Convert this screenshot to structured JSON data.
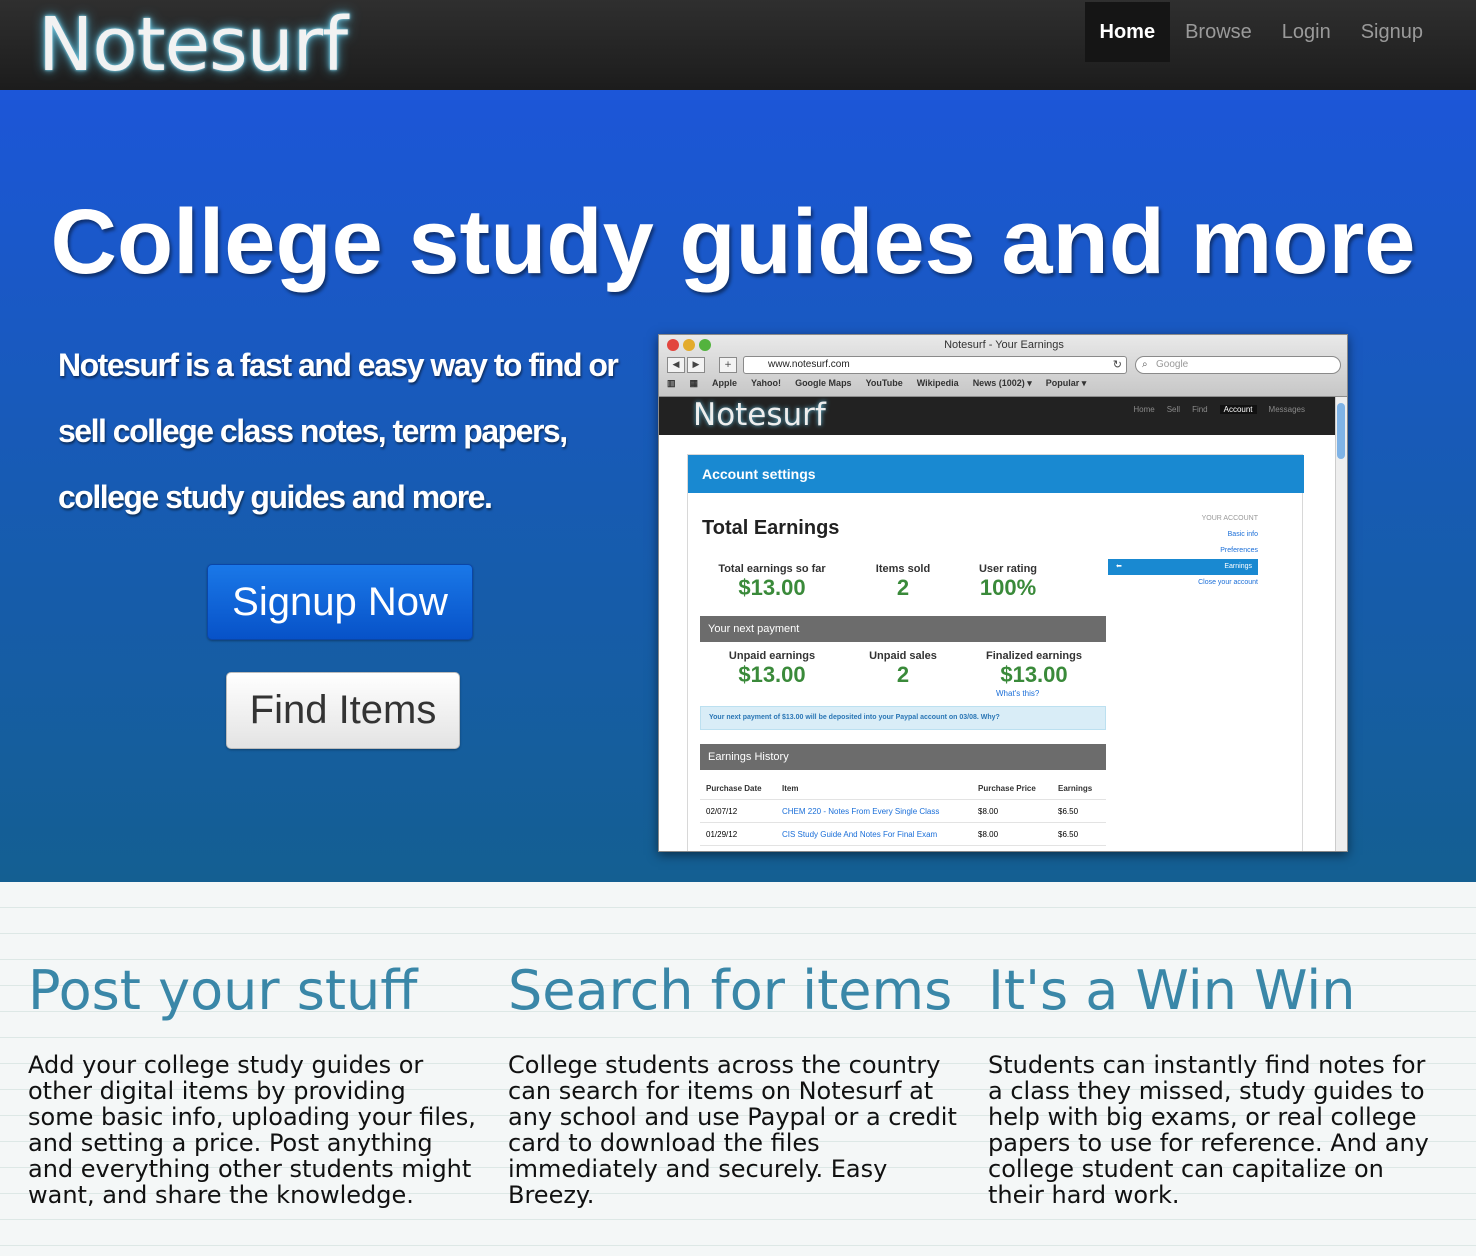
{
  "brand": {
    "logo": "Notesurf"
  },
  "nav": {
    "items": [
      "Home",
      "Browse",
      "Login",
      "Signup"
    ],
    "active": "Home"
  },
  "hero": {
    "title": "College study guides and more",
    "tagline": "Notesurf is a fast and easy way to find or sell college class notes, term papers, college study guides and more.",
    "signup_button": "Signup Now",
    "find_button": "Find Items"
  },
  "screenshot": {
    "window_title": "Notesurf - Your Earnings",
    "url": "www.notesurf.com",
    "search_placeholder": "Google",
    "bookmarks": [
      "Apple",
      "Yahoo!",
      "Google Maps",
      "YouTube",
      "Wikipedia",
      "News (1002) ▾",
      "Popular ▾"
    ],
    "inner_logo": "Notesurf",
    "inner_nav": [
      "Home",
      "Sell",
      "Find",
      "Account",
      "Messages"
    ],
    "panel_title": "Account settings",
    "total_title": "Total Earnings",
    "side_menu": {
      "header": "YOUR ACCOUNT",
      "items": [
        "Basic info",
        "Preferences",
        "Earnings",
        "Close your account"
      ]
    },
    "stats": [
      {
        "label": "Total earnings so far",
        "value": "$13.00"
      },
      {
        "label": "Items sold",
        "value": "2"
      },
      {
        "label": "User rating",
        "value": "100%"
      }
    ],
    "next_payment_bar": "Your next payment",
    "payment_stats": [
      {
        "label": "Unpaid earnings",
        "value": "$13.00"
      },
      {
        "label": "Unpaid sales",
        "value": "2"
      },
      {
        "label": "Finalized earnings",
        "value": "$13.00"
      }
    ],
    "whats_this": "What's this?",
    "notice": "Your next payment of $13.00 will be deposited into your Paypal account on 03/08. Why?",
    "history_bar": "Earnings History",
    "history_columns": [
      "Purchase Date",
      "Item",
      "Purchase Price",
      "Earnings"
    ],
    "history_rows": [
      [
        "02/07/12",
        "CHEM 220 - Notes From Every Single Class",
        "$8.00",
        "$6.50"
      ],
      [
        "01/29/12",
        "CIS Study Guide And Notes For Final Exam",
        "$8.00",
        "$6.50"
      ]
    ]
  },
  "features": [
    {
      "title": "Post your stuff",
      "body": "Add your college study guides or other digital items by providing some basic info, uploading your files, and setting a price. Post anything and everything other students might want, and share the knowledge."
    },
    {
      "title": "Search for items",
      "body": "College students across the country can search for items on Notesurf at any school and use Paypal or a credit card to download the files immediately and securely. Easy Breezy."
    },
    {
      "title": "It's a Win Win",
      "body": "Students can instantly find notes for a class they missed, study guides to help with big exams, or real college papers to use for reference. And any college student can capitalize on their hard work."
    }
  ],
  "colors": {
    "hero_top": "#1c56d8",
    "hero_bottom": "#145f92",
    "feature_heading": "#3a87a8",
    "navbar": "#222222"
  }
}
